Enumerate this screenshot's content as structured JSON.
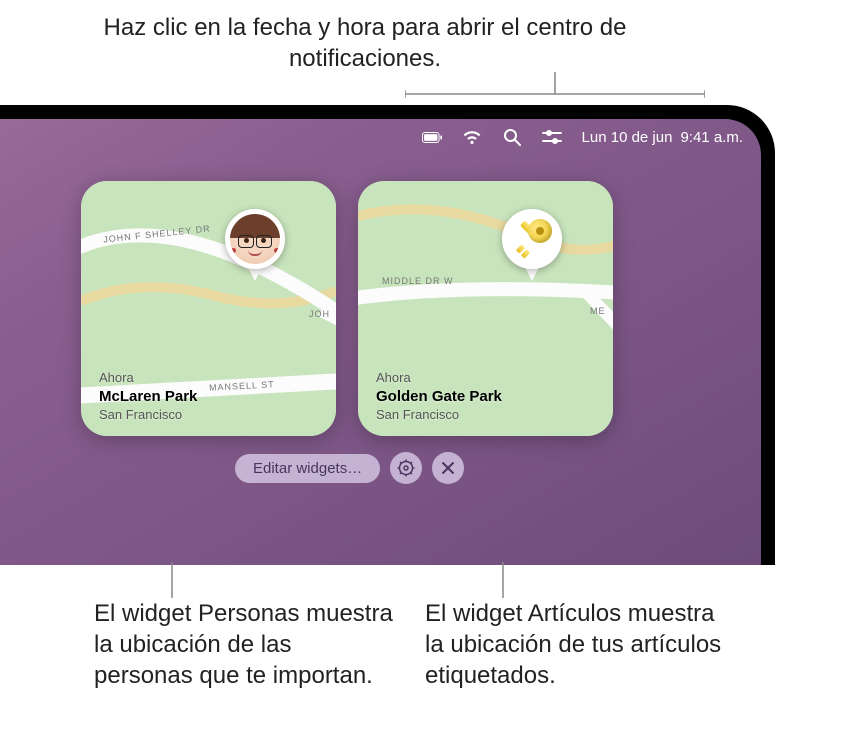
{
  "callouts": {
    "top": "Haz clic en la fecha y hora para abrir el centro de notificaciones.",
    "bottom_left": "El widget Personas muestra la ubicación de las personas que te importan.",
    "bottom_right": "El widget Artículos muestra la ubicación de tus artículos etiquetados."
  },
  "menubar": {
    "date": "Lun 10 de jun",
    "time": "9:41 a.m.",
    "icons": [
      "battery-icon",
      "wifi-icon",
      "search-icon",
      "control-center-icon"
    ]
  },
  "widgets": [
    {
      "type": "person",
      "timestamp": "Ahora",
      "location_name": "McLaren Park",
      "city": "San Francisco",
      "roads": [
        "JOHN F SHELLEY DR",
        "MANSELL ST",
        "JOH"
      ],
      "pin_kind": "avatar"
    },
    {
      "type": "item",
      "timestamp": "Ahora",
      "location_name": "Golden Gate Park",
      "city": "San Francisco",
      "roads": [
        "MIDDLE DR W",
        "ME"
      ],
      "pin_kind": "key"
    }
  ],
  "edit_bar": {
    "edit_label": "Editar widgets…"
  }
}
